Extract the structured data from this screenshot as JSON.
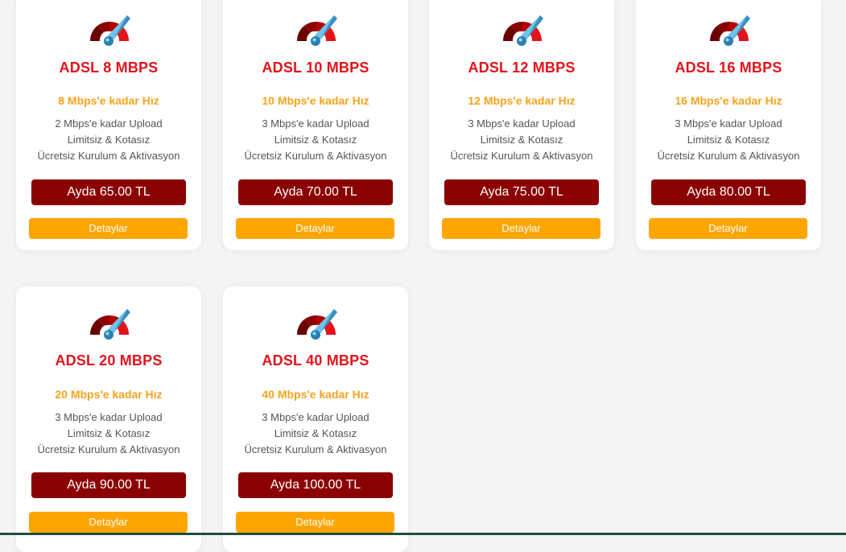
{
  "colors": {
    "title": "#e3131b",
    "speed": "#f6a31b",
    "price_bg": "#8b0000",
    "details_bg": "#ffa500"
  },
  "icon": "speedometer-icon",
  "plans": [
    {
      "title": "ADSL 8 MBPS",
      "speed": "8 Mbps'e kadar Hız",
      "upload": "2 Mbps'e kadar Upload",
      "limit": "Limitsiz & Kotasız",
      "setup": "Ücretsiz Kurulum & Aktivasyon",
      "price": "Ayda 65.00 TL",
      "details": "Detaylar"
    },
    {
      "title": "ADSL 10 MBPS",
      "speed": "10 Mbps'e kadar Hız",
      "upload": "3 Mbps'e kadar Upload",
      "limit": "Limitsiz & Kotasız",
      "setup": "Ücretsiz Kurulum & Aktivasyon",
      "price": "Ayda 70.00 TL",
      "details": "Detaylar"
    },
    {
      "title": "ADSL 12 MBPS",
      "speed": "12 Mbps'e kadar Hız",
      "upload": "3 Mbps'e kadar Upload",
      "limit": "Limitsiz & Kotasız",
      "setup": "Ücretsiz Kurulum & Aktivasyon",
      "price": "Ayda 75.00 TL",
      "details": "Detaylar"
    },
    {
      "title": "ADSL 16 MBPS",
      "speed": "16 Mbps'e kadar Hız",
      "upload": "3 Mbps'e kadar Upload",
      "limit": "Limitsiz & Kotasız",
      "setup": "Ücretsiz Kurulum & Aktivasyon",
      "price": "Ayda 80.00 TL",
      "details": "Detaylar"
    },
    {
      "title": "ADSL 20 MBPS",
      "speed": "20 Mbps'e kadar Hız",
      "upload": "3 Mbps'e kadar Upload",
      "limit": "Limitsiz & Kotasız",
      "setup": "Ücretsiz Kurulum & Aktivasyon",
      "price": "Ayda 90.00 TL",
      "details": "Detaylar"
    },
    {
      "title": "ADSL 40 MBPS",
      "speed": "40 Mbps'e kadar Hız",
      "upload": "3 Mbps'e kadar Upload",
      "limit": "Limitsiz & Kotasız",
      "setup": "Ücretsiz Kurulum & Aktivasyon",
      "price": "Ayda 100.00 TL",
      "details": "Detaylar"
    }
  ]
}
